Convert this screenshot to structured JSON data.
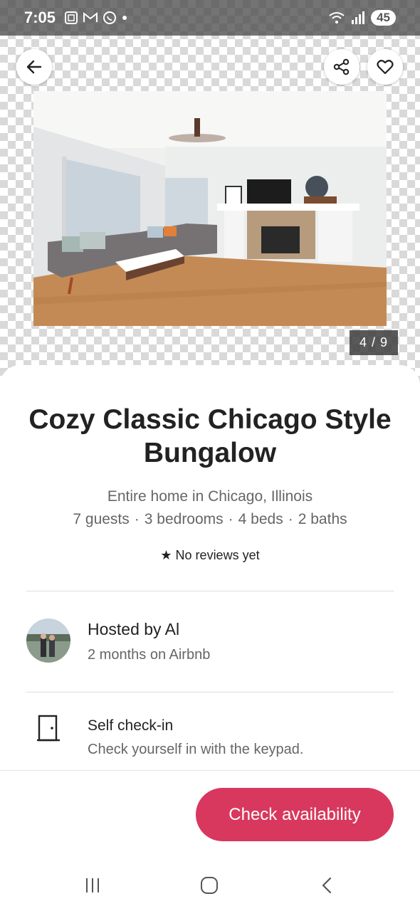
{
  "status_bar": {
    "time": "7:05",
    "battery": "45"
  },
  "photo": {
    "counter": "4 / 9"
  },
  "listing": {
    "title": "Cozy Classic Chicago Style Bungalow",
    "subtitle": "Entire home in Chicago, Illinois",
    "details": [
      "7 guests",
      "3 bedrooms",
      "4 beds",
      "2 baths"
    ],
    "reviews": "No reviews yet"
  },
  "host": {
    "name": "Hosted by Al",
    "tenure": "2 months on Airbnb"
  },
  "amenity": {
    "title": "Self check-in",
    "description": "Check yourself in with the keypad."
  },
  "cta": {
    "label": "Check availability",
    "color": "#d9385e"
  },
  "icons": {
    "back": "arrow-left-icon",
    "share": "share-icon",
    "favorite": "heart-icon",
    "star": "star-icon",
    "door": "door-icon"
  }
}
